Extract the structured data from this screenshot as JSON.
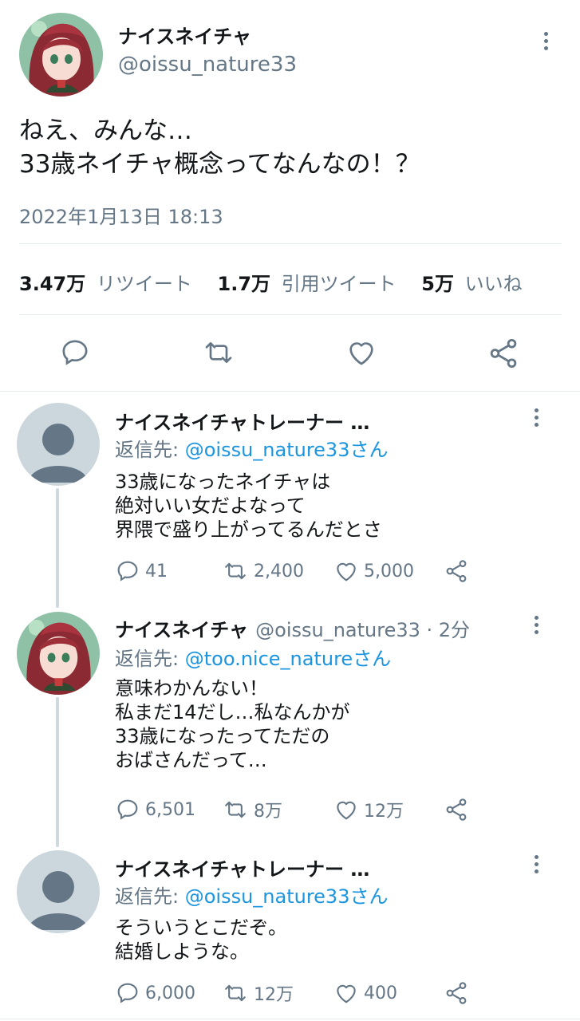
{
  "main_tweet": {
    "display_name": "ナイスネイチャ",
    "handle": "@oissu_nature33",
    "text": "ねえ、みんな…\n33歳ネイチャ概念ってなんなの！？",
    "timestamp": "2022年1月13日 18:13",
    "stats": {
      "retweets_count": "3.47万",
      "retweets_label": "リツイート",
      "quotes_count": "1.7万",
      "quotes_label": "引用ツイート",
      "likes_count": "5万",
      "likes_label": "いいね"
    }
  },
  "replies": [
    {
      "display_name": "ナイスネイチャトレーナー …",
      "reply_prefix": "返信先: ",
      "reply_to": "@oissu_nature33さん",
      "text": "33歳になったネイチャは\n絶対いい女だよなって\n界隈で盛り上がってるんだとさ",
      "replies": "41",
      "retweets": "2,400",
      "likes": "5,000"
    },
    {
      "display_name": "ナイスネイチャ",
      "meta": "@oissu_nature33 · 2分",
      "reply_prefix": "返信先: ",
      "reply_to": "@too.nice_natureさん",
      "text": "意味わかんない！\n私まだ14だし…私なんかが\n33歳になったってただの\nおばさんだって…",
      "replies": "6,501",
      "retweets": "8万",
      "likes": "12万"
    },
    {
      "display_name": "ナイスネイチャトレーナー …",
      "reply_prefix": "返信先: ",
      "reply_to": "@oissu_nature33さん",
      "text": "そういうとこだぞ。\n結婚しような。",
      "replies": "6,000",
      "retweets": "12万",
      "likes": "400"
    }
  ],
  "colors": {
    "accent": "#1b95e0",
    "secondary_text": "#657786",
    "divider": "#e6ecf0"
  },
  "icons": [
    "reply-icon",
    "retweet-icon",
    "like-icon",
    "share-icon",
    "more-icon",
    "default-avatar",
    "character-avatar"
  ]
}
